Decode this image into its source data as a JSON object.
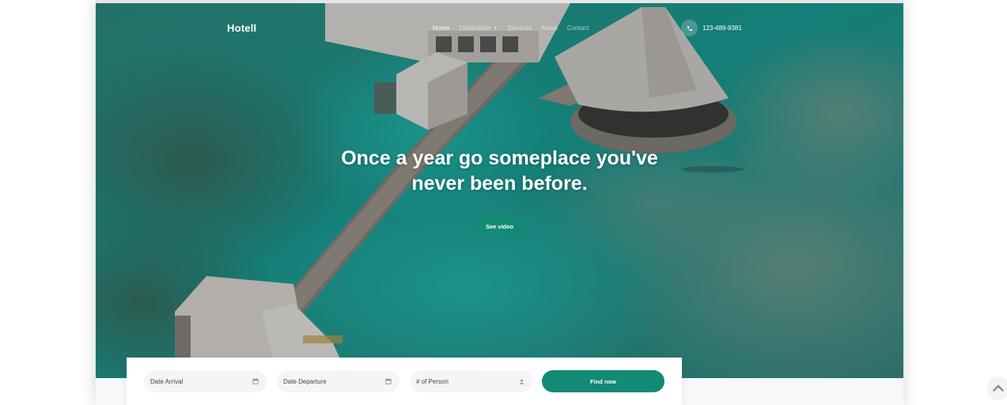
{
  "brand": "Hotell",
  "nav": {
    "items": [
      {
        "label": "Home",
        "active": true
      },
      {
        "label": "Destination",
        "dropdown": true
      },
      {
        "label": "Services"
      },
      {
        "label": "About"
      },
      {
        "label": "Contact"
      }
    ]
  },
  "contact": {
    "phone": "123-489-9381",
    "icon": "phone-icon"
  },
  "hero": {
    "title_line1": "Once a year go someplace you've",
    "title_line2": "never been before.",
    "cta_label": "See video"
  },
  "booking": {
    "arrival_placeholder": "Date Arrival",
    "departure_placeholder": "Date Departure",
    "persons_placeholder": "# of Person",
    "submit_label": "Find now",
    "calendar_icon": "calendar-icon",
    "person_icon": "person-icon"
  },
  "scroll_top": {
    "icon": "chevron-up-icon"
  },
  "colors": {
    "accent": "#138a73",
    "field_bg": "#f4f5f7",
    "hero_water": "#2a8c87"
  }
}
